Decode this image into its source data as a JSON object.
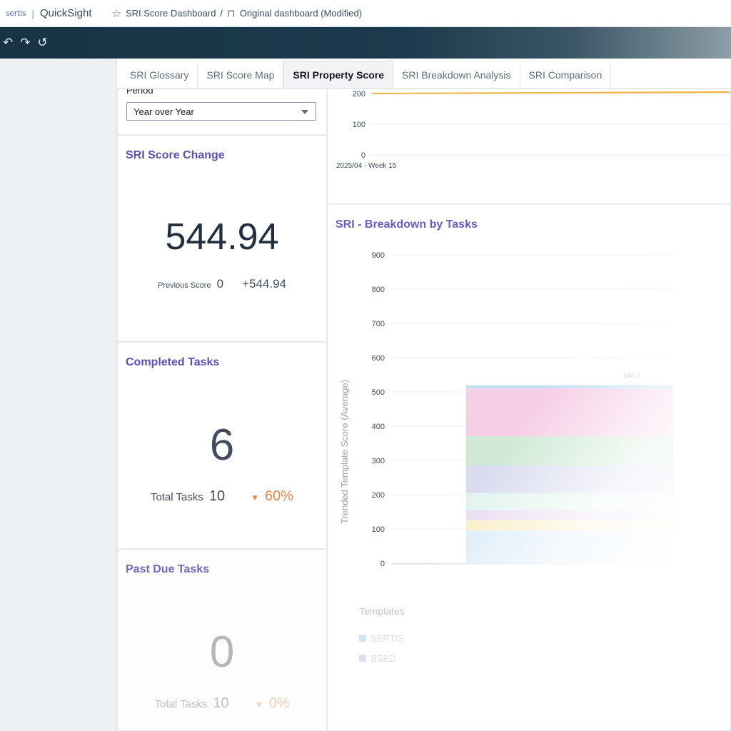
{
  "header": {
    "brand": "sertis",
    "app_name": "QuickSight",
    "breadcrumb": [
      "SRI Score Dashboard",
      "/",
      "Original dashboard (Modified)"
    ]
  },
  "toolbar": {
    "icons": [
      "undo-icon",
      "redo-icon",
      "reset-icon"
    ],
    "glyphs": [
      "↶",
      "↷",
      "↺"
    ]
  },
  "tabs": [
    {
      "label": "SRI Glossary",
      "active": false
    },
    {
      "label": "SRI Score Map",
      "active": false
    },
    {
      "label": "SRI Property Score",
      "active": true
    },
    {
      "label": "SRI Breakdown Analysis",
      "active": false
    },
    {
      "label": "SRI Comparison",
      "active": false
    }
  ],
  "filter": {
    "label": "Period",
    "selected": "Year over Year"
  },
  "score_change": {
    "title": "SRI Score Change",
    "value": "544.94",
    "previous_label": "Previous Score",
    "previous_value": "0",
    "delta": "+544.94"
  },
  "completed_tasks": {
    "title": "Completed Tasks",
    "value": "6",
    "total_label": "Total Tasks",
    "total_value": "10",
    "change": "60%",
    "change_color": "#e8874a"
  },
  "past_due_tasks": {
    "title": "Past Due Tasks",
    "value": "0",
    "total_label": "Total Tasks",
    "total_value": "10",
    "change": "0%",
    "change_color": "#e8874a"
  },
  "chart_data": [
    {
      "type": "line",
      "title": "",
      "x": [
        "2025/04 - Week 15"
      ],
      "yticks": [
        0,
        100,
        200
      ],
      "series": [
        {
          "values": [
            200
          ],
          "color": "#f0b43c"
        }
      ]
    },
    {
      "type": "bar",
      "title": "SRI - Breakdown by Tasks",
      "ylabel": "Trended Template Score (Average)",
      "yticks": [
        0,
        100,
        200,
        300,
        400,
        500,
        600,
        700,
        800,
        900
      ],
      "ylim": [
        0,
        900
      ],
      "categories": [
        ""
      ],
      "stacked_segments": [
        {
          "value": 95,
          "color": "#dcecf8"
        },
        {
          "value": 30,
          "color": "#fbefc6"
        },
        {
          "value": 30,
          "color": "#eadcf2"
        },
        {
          "value": 50,
          "color": "#e3f4ee"
        },
        {
          "value": 80,
          "color": "#d9dcef"
        },
        {
          "value": 85,
          "color": "#cfe9d6"
        },
        {
          "value": 140,
          "color": "#f6cfe6"
        },
        {
          "value": 10,
          "color": "#c6dff3"
        }
      ],
      "total_label": "544.9",
      "legend_title": "Templates",
      "legend": [
        {
          "name": "SERTIS",
          "color": "#cfe6f7"
        },
        {
          "name": "SSBD",
          "color": "#dddff0"
        }
      ]
    }
  ]
}
